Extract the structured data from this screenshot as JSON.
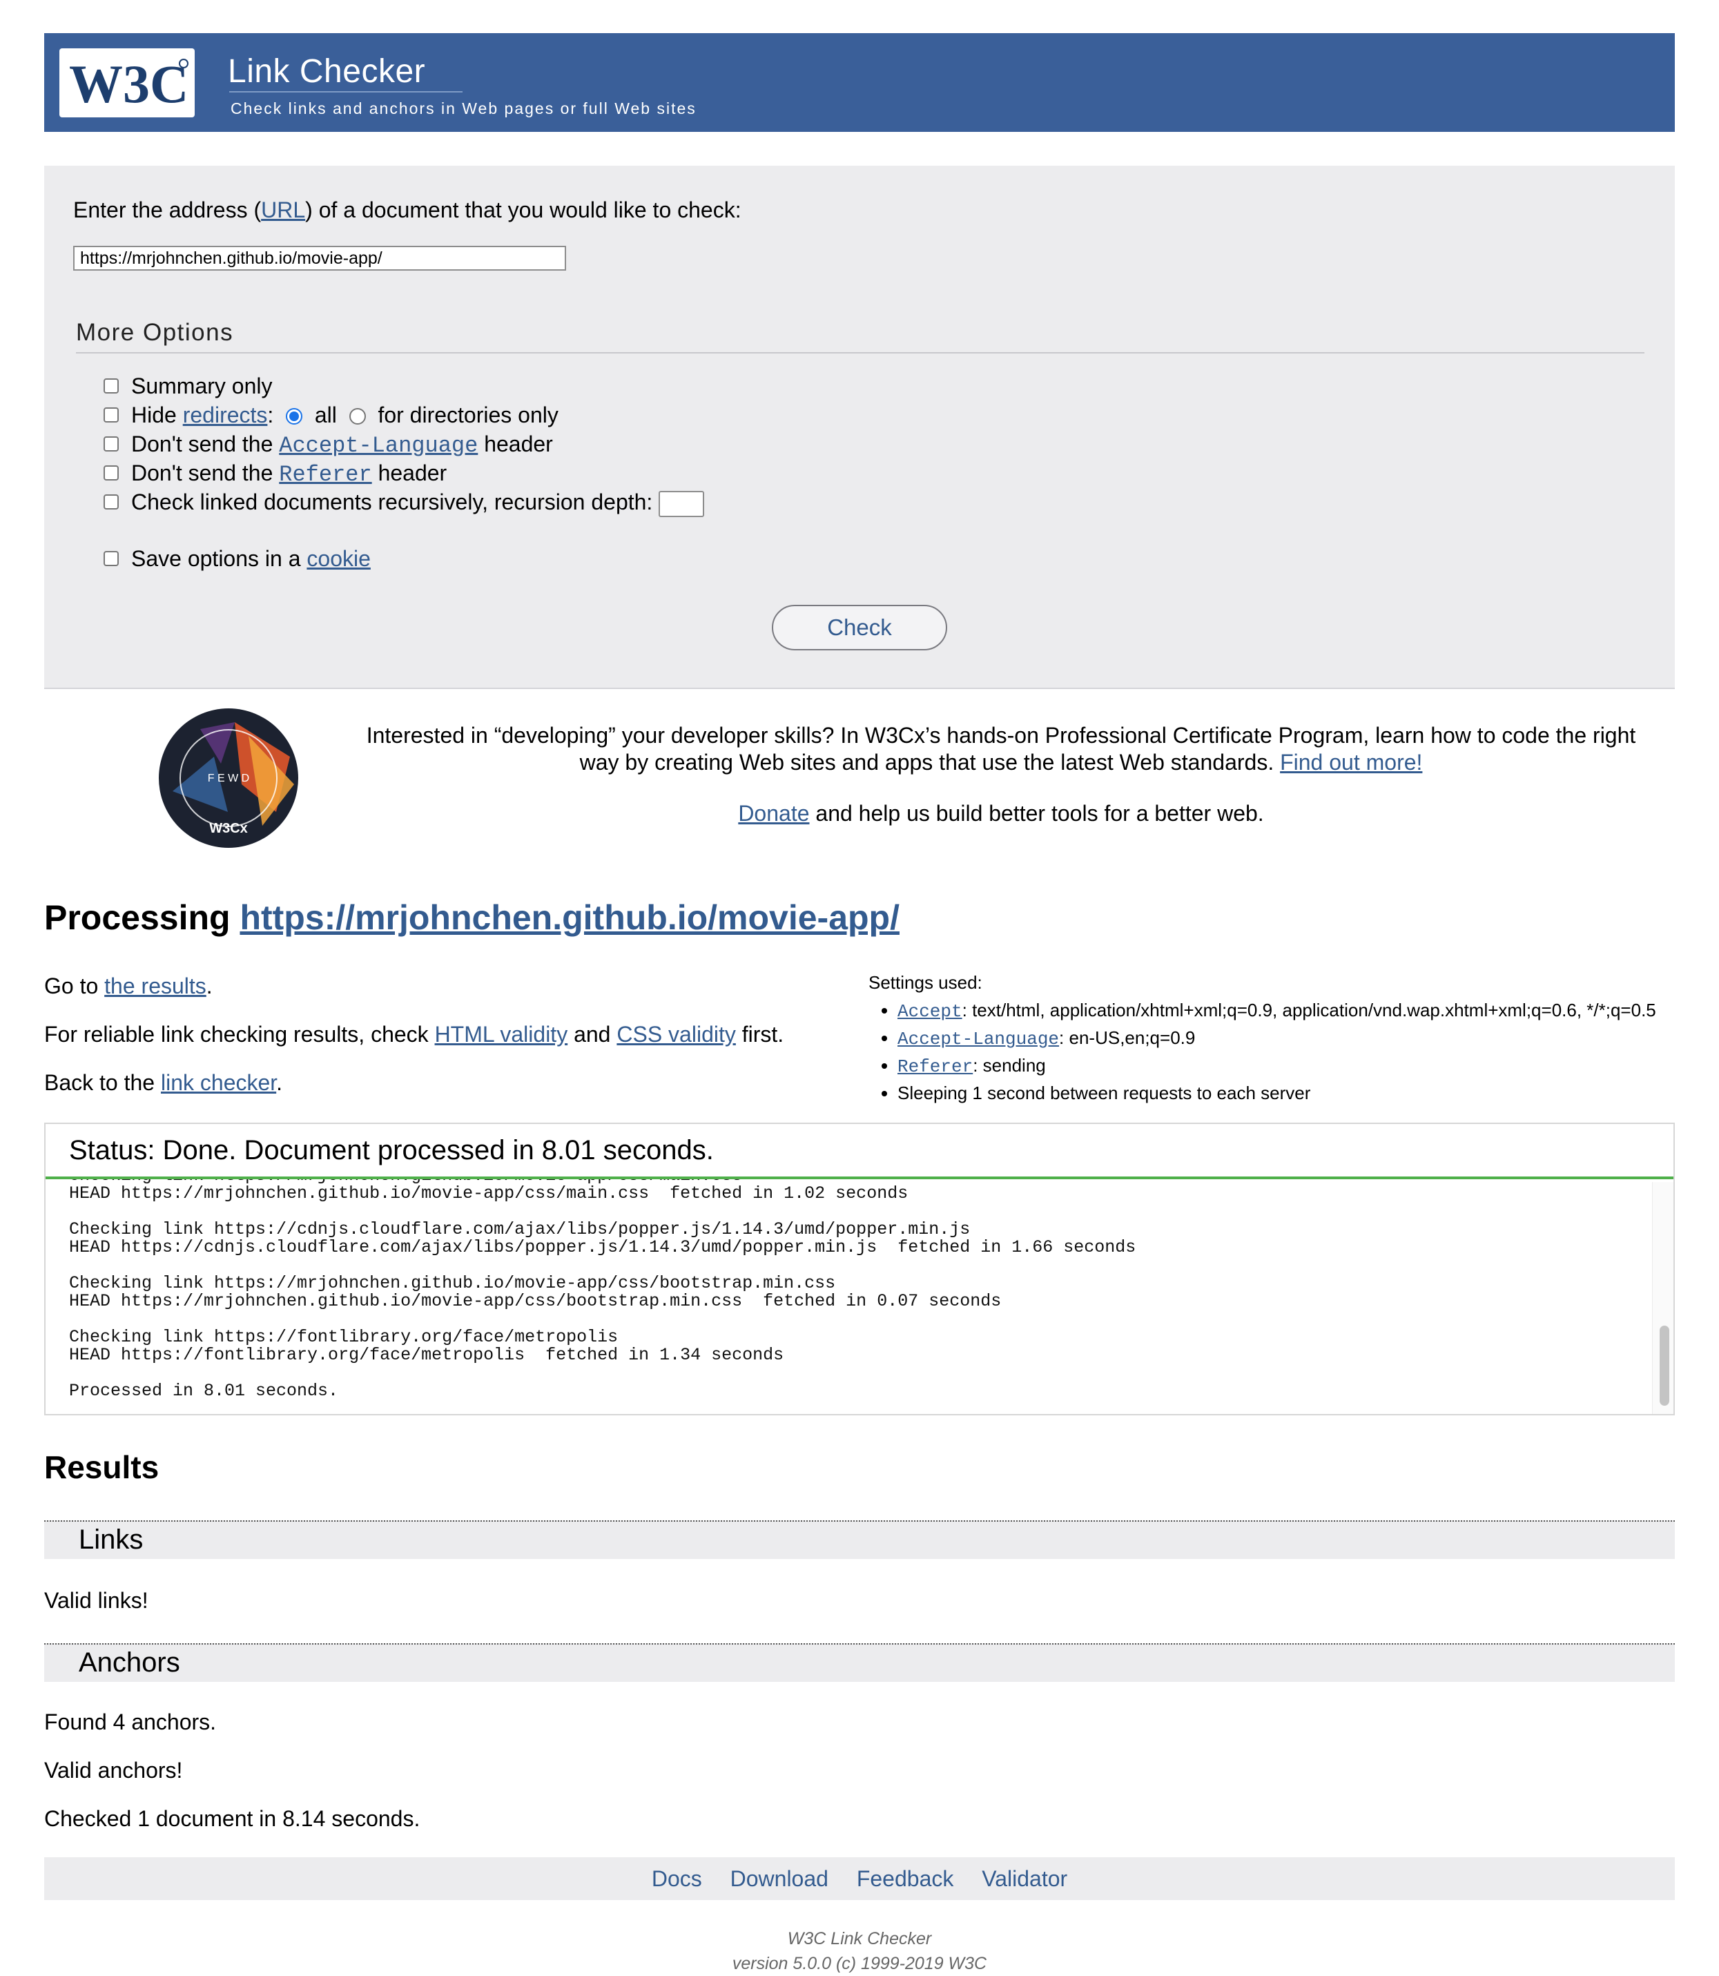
{
  "banner": {
    "logo_text": "W3C",
    "title": "Link Checker",
    "subtitle": "Check links and anchors in Web pages or full Web sites"
  },
  "form": {
    "prompt_before": "Enter the address (",
    "prompt_link": "URL",
    "prompt_after": ") of a document that you would like to check:",
    "url_value": "https://mrjohnchen.github.io/movie-app/",
    "more_options_title": "More Options",
    "summary_only": "Summary only",
    "hide_label": "Hide ",
    "redirects_link": "redirects",
    "colon": ":",
    "radio_all": "all",
    "radio_dirs": "for directories only",
    "dont_send_the": "Don't send the ",
    "accept_language_link": "Accept-Language",
    "referer_link": "Referer",
    "header_word": " header",
    "recursive_label": "Check linked documents recursively, recursion depth:",
    "save_options_label": "Save options in a ",
    "cookie_link": "cookie",
    "check_button": "Check"
  },
  "promo": {
    "badge_alt_text": "FRONT END WEB DEVELOPER W3Cx",
    "text": "Interested in “developing” your developer skills? In W3Cx’s hands-on Professional Certificate Program, learn how to code the right way by creating Web sites and apps that use the latest Web standards.",
    "find_out_link": "Find out more!",
    "donate_link": "Donate",
    "donate_text": " and help us build better tools for a better web."
  },
  "processing": {
    "title_prefix": "Processing ",
    "title_link": "https://mrjohnchen.github.io/movie-app/",
    "goto_prefix": "Go to ",
    "goto_link": "the results",
    "goto_suffix": ".",
    "reliable_prefix": "For reliable link checking results, check ",
    "html_validity_link": "HTML validity",
    "and_word": " and ",
    "css_validity_link": "CSS validity",
    "reliable_suffix": " first.",
    "back_prefix": "Back to the ",
    "link_checker_link": "link checker",
    "back_suffix": "."
  },
  "settings": {
    "title": "Settings used:",
    "accept_link": "Accept",
    "accept_value": ": text/html, application/xhtml+xml;q=0.9, application/vnd.wap.xhtml+xml;q=0.6, */*;q=0.5",
    "accept_language_link": "Accept-Language",
    "accept_language_value": ": en-US,en;q=0.9",
    "referer_link": "Referer",
    "referer_value": ": sending",
    "sleeping": "Sleeping 1 second between requests to each server"
  },
  "status": {
    "heading": "Status: Done. Document processed in 8.01 seconds.",
    "log": "Checking link https://mrjohnchen.github.io/movie-app/css/main.css\nHEAD https://mrjohnchen.github.io/movie-app/css/main.css  fetched in 1.02 seconds\n\nChecking link https://cdnjs.cloudflare.com/ajax/libs/popper.js/1.14.3/umd/popper.min.js\nHEAD https://cdnjs.cloudflare.com/ajax/libs/popper.js/1.14.3/umd/popper.min.js  fetched in 1.66 seconds\n\nChecking link https://mrjohnchen.github.io/movie-app/css/bootstrap.min.css\nHEAD https://mrjohnchen.github.io/movie-app/css/bootstrap.min.css  fetched in 0.07 seconds\n\nChecking link https://fontlibrary.org/face/metropolis\nHEAD https://fontlibrary.org/face/metropolis  fetched in 1.34 seconds\n\nProcessed in 8.01 seconds."
  },
  "results": {
    "title": "Results",
    "links_heading": "Links",
    "links_text": "Valid links!",
    "anchors_heading": "Anchors",
    "anchors_found": "Found 4 anchors.",
    "anchors_valid": "Valid anchors!",
    "checked": "Checked 1 document in 8.14 seconds."
  },
  "footer": {
    "links": [
      "Docs",
      "Download",
      "Feedback",
      "Validator"
    ],
    "note_line1": "W3C Link Checker",
    "note_line2": "version 5.0.0 (c) 1999-2019 W3C"
  },
  "colors": {
    "banner": "#3a5f99",
    "link": "#335b8f",
    "panel": "#ececee",
    "status_rule": "#4fb04a"
  }
}
